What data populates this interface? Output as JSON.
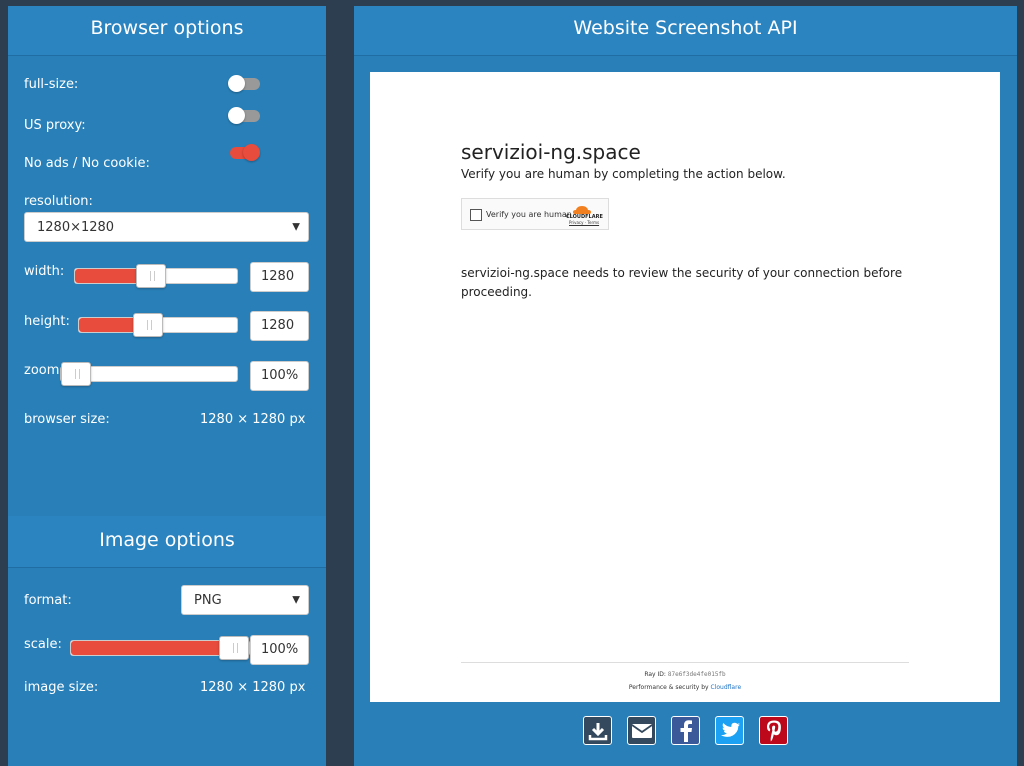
{
  "browser_options": {
    "title": "Browser options",
    "full_size_label": "full-size:",
    "full_size_on": false,
    "us_proxy_label": "US proxy:",
    "us_proxy_on": false,
    "noads_label": "No ads / No cookie:",
    "noads_on": true,
    "resolution_label": "resolution:",
    "resolution_value": "1280×1280",
    "width_label": "width:",
    "width_value": "1280",
    "width_fraction": 0.46,
    "height_label": "height:",
    "height_value": "1280",
    "height_fraction": 0.42,
    "zoom_label": "zoom:",
    "zoom_value": "100%",
    "zoom_fraction": 0.0,
    "browser_size_label": "browser size:",
    "browser_size_value": "1280 × 1280 px"
  },
  "image_options": {
    "title": "Image options",
    "format_label": "format:",
    "format_value": "PNG",
    "scale_label": "scale:",
    "scale_value": "100%",
    "scale_fraction": 1.0,
    "image_size_label": "image size:",
    "image_size_value": "1280 × 1280 px"
  },
  "main": {
    "title": "Website Screenshot API"
  },
  "preview": {
    "site_title": "servizioi-ng.space",
    "subtitle": "Verify you are human by completing the action below.",
    "checkbox_label": "Verify you are human",
    "cf_brand": "CLOUDFLARE",
    "cf_links": "Privacy · Terms",
    "message": "servizioi-ng.space needs to review the security of your connection before proceeding.",
    "ray_label": "Ray ID:",
    "ray_id": "87e6f3de4fe015fb",
    "perf_text": "Performance & security by",
    "perf_link": "Cloudflare"
  },
  "share": [
    {
      "name": "download",
      "color": "#34495e"
    },
    {
      "name": "email",
      "color": "#34495e"
    },
    {
      "name": "facebook",
      "color": "#3b5998"
    },
    {
      "name": "twitter",
      "color": "#1da1f2"
    },
    {
      "name": "pinterest",
      "color": "#bd081c"
    }
  ],
  "colors": {
    "page_bg": "#2c3e50",
    "panel_bg": "#2980b9",
    "accent_red": "#e74c3c"
  }
}
